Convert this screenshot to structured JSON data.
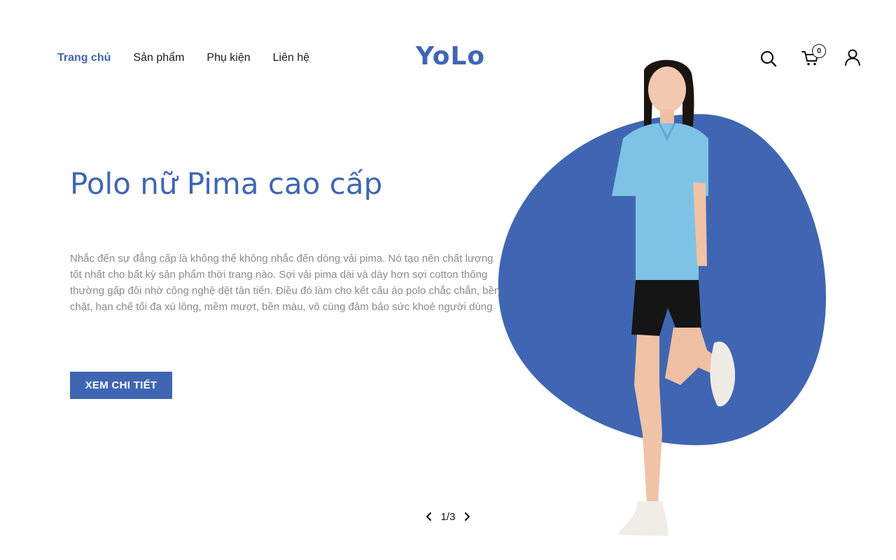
{
  "nav": {
    "items": [
      {
        "label": "Trang chủ",
        "active": true
      },
      {
        "label": "Sản phẩm",
        "active": false
      },
      {
        "label": "Phụ kiện",
        "active": false
      },
      {
        "label": "Liên hệ",
        "active": false
      }
    ]
  },
  "brand": {
    "logo_text": "YoLo",
    "color": "#4066b3"
  },
  "header_icons": {
    "search": "search-icon",
    "cart": "cart-icon",
    "cart_count": "0",
    "user": "user-icon"
  },
  "hero": {
    "title": "Polo nữ Pima cao cấp",
    "description": "Nhắc đến sự đẳng cấp là không thể không nhắc đến dòng vải pima. Nó tạo nên chất lượng tốt nhất cho bất kỳ sản phẩm thời trang nào. Sợi vải pima dài và dày hơn sợi cotton thông thường gấp đôi nhờ công nghệ dệt tân tiến. Điều đó làm cho kết cấu áo polo chắc chắn, bền chặt, hạn chế tối đa xù lông, mềm mượt, bền màu, vô cùng đảm bảo sức khoẻ người dùng",
    "cta_label": "XEM CHI TIẾT",
    "accent_color": "#4066b3"
  },
  "pager": {
    "label": "1/3",
    "current": 1,
    "total": 3
  }
}
